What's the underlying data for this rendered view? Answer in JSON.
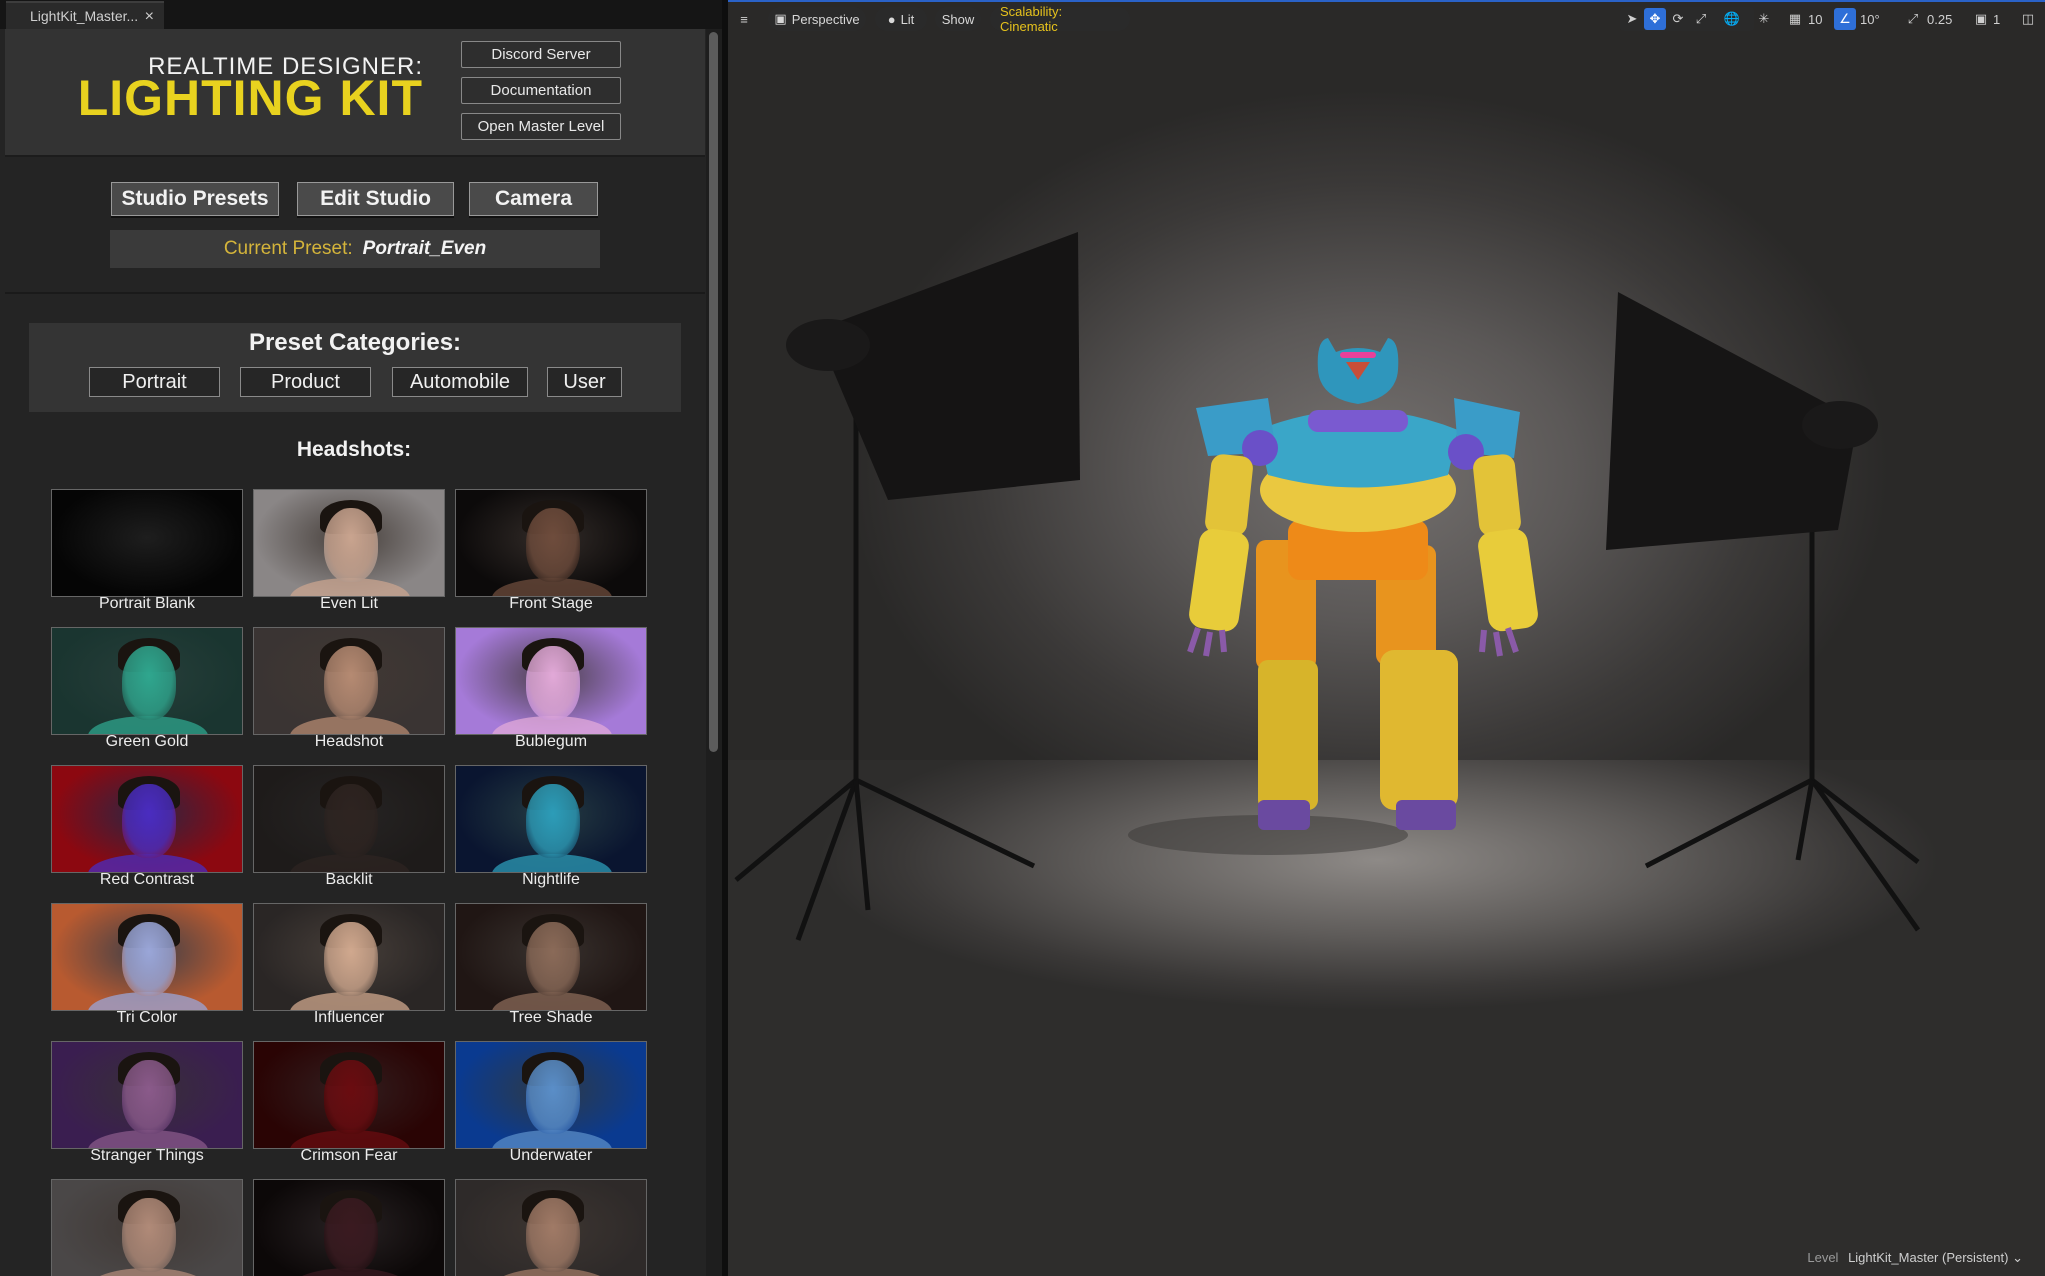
{
  "tab": {
    "title": "LightKit_Master...",
    "close": "×"
  },
  "banner": {
    "subtitle": "REALTIME DESIGNER:",
    "title": "LIGHTING KIT",
    "links": [
      "Discord Server",
      "Documentation",
      "Open Master Level"
    ]
  },
  "modes": [
    "Studio Presets",
    "Edit Studio",
    "Camera"
  ],
  "current_preset": {
    "label": "Current Preset:",
    "value": "Portrait_Even"
  },
  "categories": {
    "title": "Preset Categories:",
    "items": [
      "Portrait",
      "Product",
      "Automobile",
      "User"
    ]
  },
  "section_title": "Headshots:",
  "presets": [
    {
      "name": "Portrait Blank",
      "bg": "#050505",
      "skin": "#050505"
    },
    {
      "name": "Even Lit",
      "bg": "#8a8686",
      "skin": "#c9a48f"
    },
    {
      "name": "Front Stage",
      "bg": "#0c0a0a",
      "skin": "#6e4c3c"
    },
    {
      "name": "Green Gold",
      "bg": "#1a3530",
      "skin": "#2fa68e"
    },
    {
      "name": "Headshot",
      "bg": "#3a3433",
      "skin": "#b58a72"
    },
    {
      "name": "Bublegum",
      "bg": "#a57ad8",
      "skin": "#e2a9d8"
    },
    {
      "name": "Red Contrast",
      "bg": "#8c0810",
      "skin": "#4a2cc0"
    },
    {
      "name": "Backlit",
      "bg": "#1e1b1a",
      "skin": "#2e2421"
    },
    {
      "name": "Nightlife",
      "bg": "#0a1530",
      "skin": "#2c9cb8"
    },
    {
      "name": "Tri Color",
      "bg": "#b85a30",
      "skin": "#9aa6d8"
    },
    {
      "name": "Influencer",
      "bg": "#2a2625",
      "skin": "#d0a88e"
    },
    {
      "name": "Tree Shade",
      "bg": "#201614",
      "skin": "#8a6a58"
    },
    {
      "name": "Stranger Things",
      "bg": "#3a1e50",
      "skin": "#8a5a8a"
    },
    {
      "name": "Crimson Fear",
      "bg": "#2a0404",
      "skin": "#6a0c10"
    },
    {
      "name": "Underwater",
      "bg": "#0a3a90",
      "skin": "#5a8ec8"
    },
    {
      "name": "",
      "bg": "#4a4747",
      "skin": "#b08a78"
    },
    {
      "name": "",
      "bg": "#0c0808",
      "skin": "#3a1a20"
    },
    {
      "name": "",
      "bg": "#2e2a29",
      "skin": "#a07a66"
    }
  ],
  "toolbar": {
    "menu_icon": "≡",
    "perspective": "Perspective",
    "lit": "Lit",
    "show": "Show",
    "scalability": "Scalability: Cinematic",
    "grid_value": "10",
    "angle_value": "10°",
    "scale_value": "0.25",
    "camera_value": "1"
  },
  "level": {
    "label": "Level",
    "value": "LightKit_Master (Persistent)",
    "chevron": "⌄"
  },
  "colors": {
    "accent_yellow": "#e8d21f",
    "accent_blue": "#2e6fd8"
  }
}
